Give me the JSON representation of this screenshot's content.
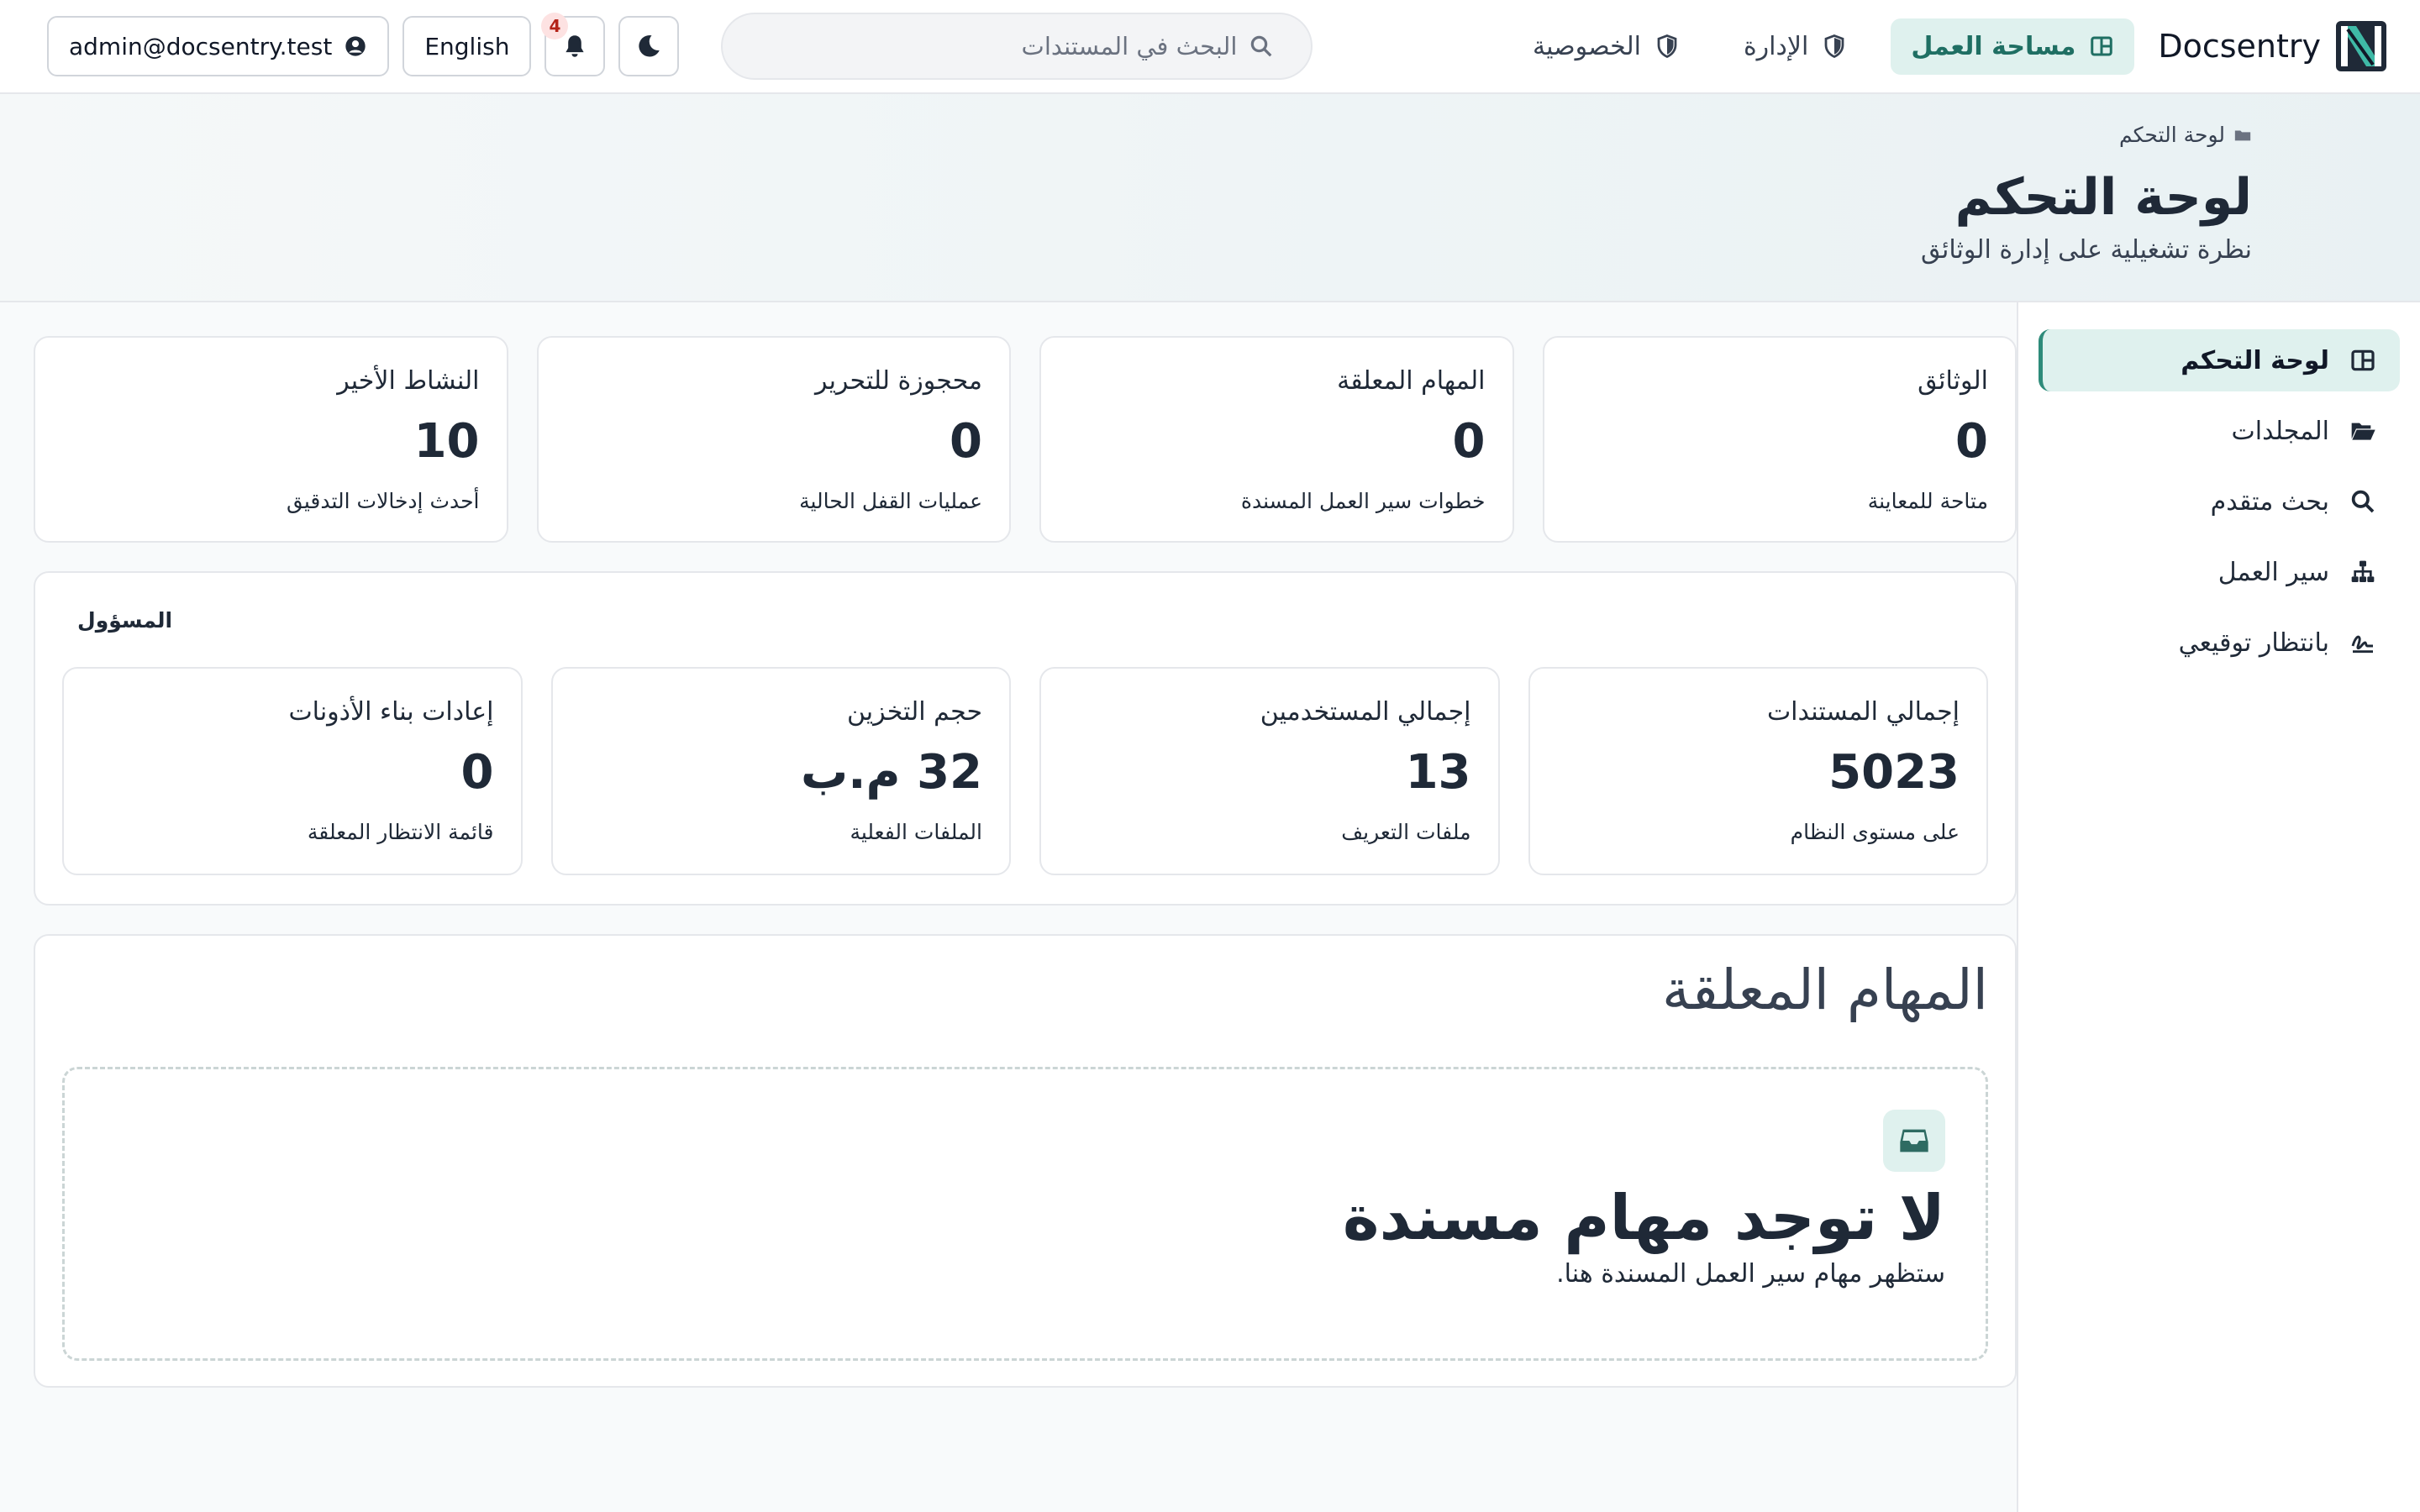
{
  "brand": {
    "name": "Docsentry",
    "logo_icon": "docsentry-logo-icon"
  },
  "nav": {
    "workspace": "مساحة العمل",
    "admin": "الإدارة",
    "privacy": "الخصوصية"
  },
  "search": {
    "placeholder": "البحث في المستندات",
    "value": ""
  },
  "toolbar": {
    "notification_count": "4",
    "language_label": "English",
    "user_email": "admin@docsentry.test"
  },
  "page": {
    "breadcrumb": "لوحة التحكم",
    "title": "لوحة التحكم",
    "subtitle": "نظرة تشغيلية على إدارة الوثائق"
  },
  "sidebar": {
    "items": [
      {
        "label": "لوحة التحكم",
        "icon": "dashboard-icon",
        "active": true
      },
      {
        "label": "المجلدات",
        "icon": "folder-open-icon",
        "active": false
      },
      {
        "label": "بحث متقدم",
        "icon": "search-icon",
        "active": false
      },
      {
        "label": "سير العمل",
        "icon": "sitemap-icon",
        "active": false
      },
      {
        "label": "بانتظار توقيعي",
        "icon": "signature-icon",
        "active": false
      }
    ]
  },
  "stats": [
    {
      "label": "الوثائق",
      "value": "0",
      "note": "متاحة للمعاينة"
    },
    {
      "label": "المهام المعلقة",
      "value": "0",
      "note": "خطوات سير العمل المسندة"
    },
    {
      "label": "محجوزة للتحرير",
      "value": "0",
      "note": "عمليات القفل الحالية"
    },
    {
      "label": "النشاط الأخير",
      "value": "10",
      "note": "أحدث إدخالات التدقيق"
    }
  ],
  "admin": {
    "title": "المسؤول",
    "cards": [
      {
        "label": "إجمالي المستندات",
        "value": "5023",
        "note": "على مستوى النظام"
      },
      {
        "label": "إجمالي المستخدمين",
        "value": "13",
        "note": "ملفات التعريف"
      },
      {
        "label": "حجم التخزين",
        "value": "32 م.ب",
        "note": "الملفات الفعلية"
      },
      {
        "label": "إعادات بناء الأذونات",
        "value": "0",
        "note": "قائمة الانتظار المعلقة"
      }
    ]
  },
  "tasks": {
    "title": "المهام المعلقة",
    "empty_title": "لا توجد مهام مسندة",
    "empty_desc": "ستظهر مهام سير العمل المسندة هنا."
  },
  "colors": {
    "accent": "#2e8b7a",
    "accent_bg": "#dff1ee",
    "badge_bg": "#fde2e2",
    "badge_text": "#b42318"
  }
}
